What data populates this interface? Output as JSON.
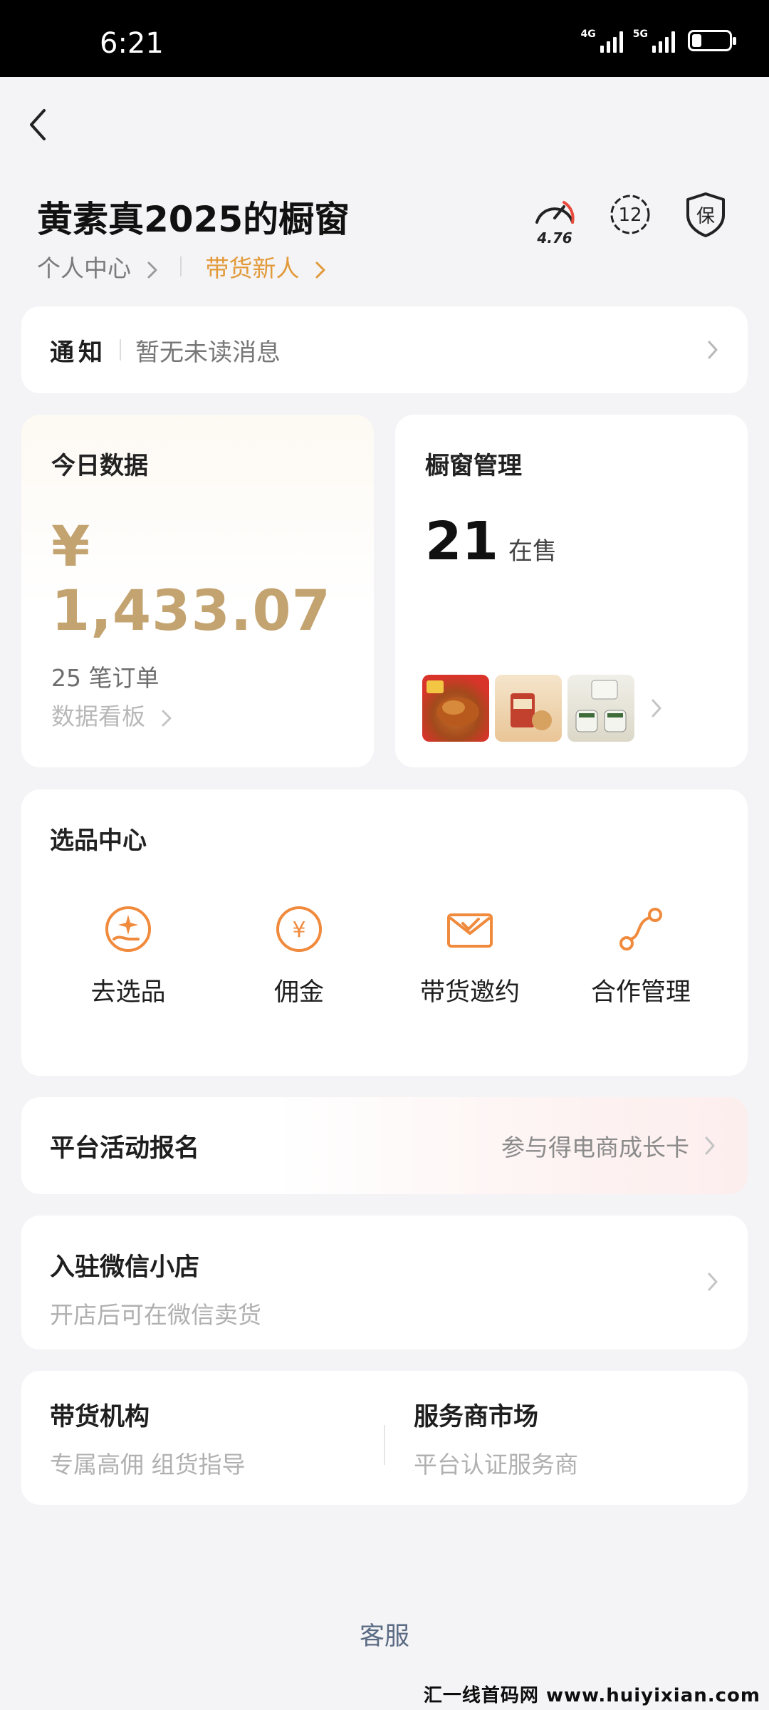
{
  "status_bar": {
    "time": "6:21",
    "net1": "4G",
    "net2": "5G",
    "battery_level_percent": 25
  },
  "header": {
    "title": "黄素真2025的橱窗",
    "personal_center": "个人中心",
    "new_seller_tag": "带货新人",
    "speed_score": "4.76",
    "badge_number": "12",
    "guarantee_label": "保"
  },
  "notice": {
    "label": "通知",
    "message": "暂无未读消息"
  },
  "today_data": {
    "title": "今日数据",
    "amount": "¥ 1,433.07",
    "orders": "25 笔订单",
    "board_link": "数据看板"
  },
  "window_management": {
    "title": "橱窗管理",
    "count": "21",
    "on_sale_label": "在售"
  },
  "select_center": {
    "title": "选品中心",
    "items": [
      {
        "label": "去选品",
        "icon": "hand-star-icon"
      },
      {
        "label": "佣金",
        "icon": "yuan-coin-icon"
      },
      {
        "label": "带货邀约",
        "icon": "invite-envelope-icon"
      },
      {
        "label": "合作管理",
        "icon": "cooperation-icon"
      }
    ]
  },
  "platform_activity": {
    "title": "平台活动报名",
    "right_text": "参与得电商成长卡"
  },
  "wechat_shop": {
    "title": "入驻微信小店",
    "subtitle": "开店后可在微信卖货"
  },
  "agency": {
    "title": "带货机构",
    "subtitle": "专属高佣 组货指导"
  },
  "service_market": {
    "title": "服务商市场",
    "subtitle": "平台认证服务商"
  },
  "customer_service": "客服",
  "watermark": "汇一线首码网 www.huiyixian.com",
  "colors": {
    "accent_gold": "#c3a370",
    "tag_orange": "#e29a3a",
    "icon_orange": "#f08a3c",
    "service_blue": "#5b6b84"
  }
}
